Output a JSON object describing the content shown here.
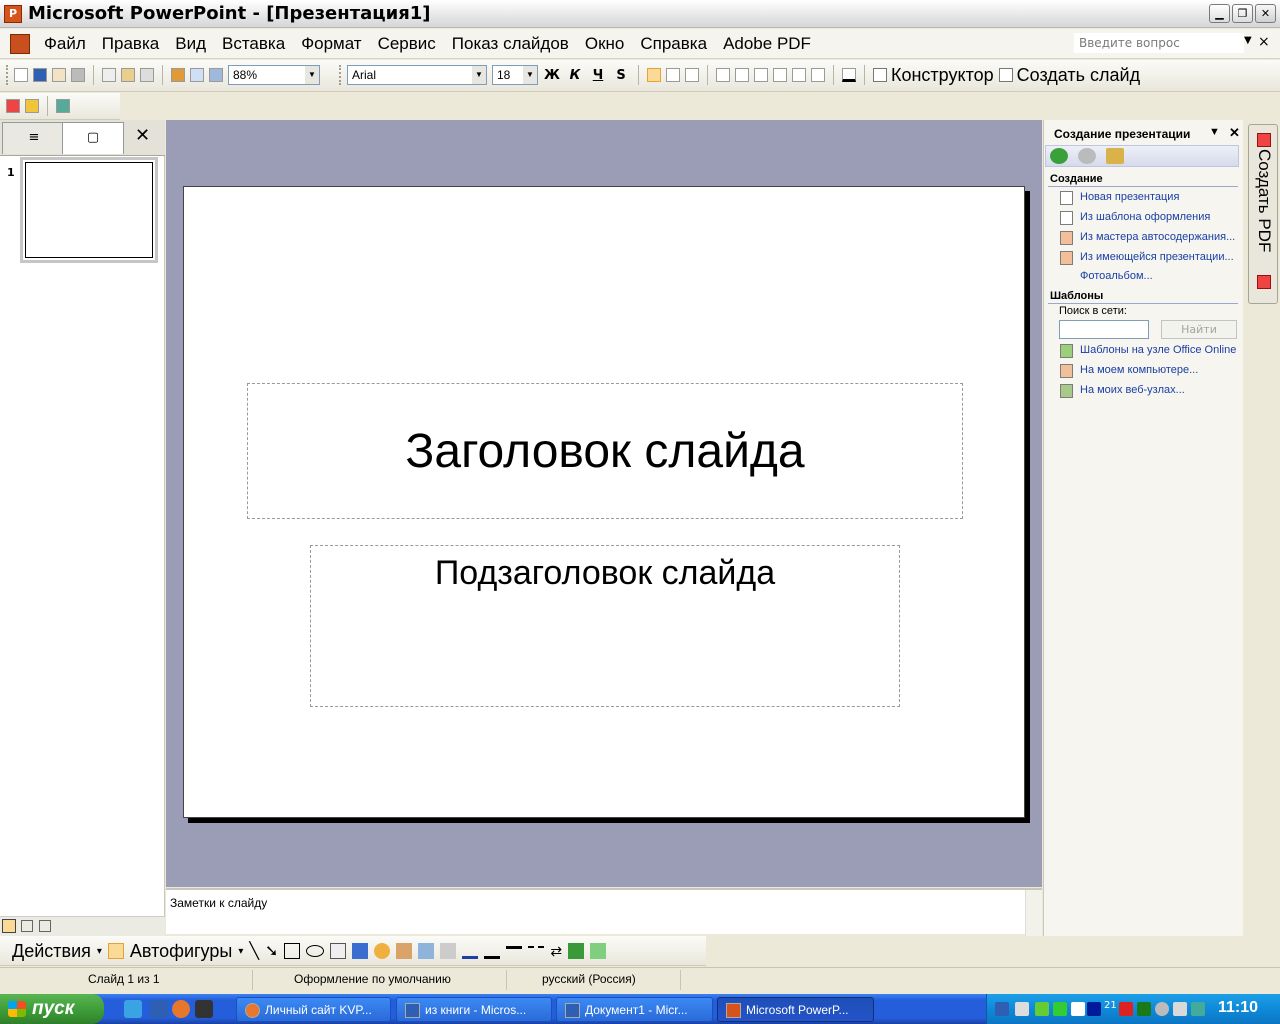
{
  "window": {
    "title": "Microsoft PowerPoint - [Презентация1]",
    "minimize_glyph": "▁",
    "restore_glyph": "❐",
    "close_glyph": "✕"
  },
  "menu": {
    "items": [
      "Файл",
      "Правка",
      "Вид",
      "Вставка",
      "Формат",
      "Сервис",
      "Показ слайдов",
      "Окно",
      "Справка",
      "Adobe PDF"
    ],
    "ask_placeholder": "Введите вопрос",
    "close_glyph": "×"
  },
  "toolbar": {
    "zoom": "88%",
    "font": "Arial",
    "size": "18",
    "bold": "Ж",
    "italic": "К",
    "underline": "Ч",
    "shadow": "S",
    "designer": "Конструктор",
    "new_slide": "Создать слайд"
  },
  "left_pane": {
    "close_glyph": "✕",
    "slide_number": "1"
  },
  "slide": {
    "title": "Заголовок слайда",
    "subtitle": "Подзаголовок слайда"
  },
  "notes": {
    "text": "Заметки к слайду"
  },
  "task_pane": {
    "title": "Создание презентации",
    "section_create": "Создание",
    "create_links": [
      "Новая презентация",
      "Из шаблона оформления",
      "Из мастера автосодержания...",
      "Из имеющейся презентации...",
      "Фотоальбом..."
    ],
    "section_templates": "Шаблоны",
    "search_label": "Поиск в сети:",
    "find_button": "Найти",
    "template_links": [
      "Шаблоны на узле Office Online",
      "На моем компьютере...",
      "На моих веб-узлах..."
    ],
    "pdf_tab": "Создать PDF"
  },
  "draw_toolbar": {
    "actions": "Действия",
    "autoshapes": "Автофигуры"
  },
  "status": {
    "slide": "Слайд 1 из 1",
    "design": "Оформление по умолчанию",
    "language": "русский (Россия)"
  },
  "taskbar": {
    "start": "пуск",
    "tasks": [
      "Личный сайт KVP...",
      "из книги - Micros...",
      "Документ1 - Micr...",
      "Microsoft PowerP..."
    ],
    "tray_number": "21",
    "clock": "11:10"
  },
  "colors": {
    "workspace": "#9a9db5",
    "taskbar": "#245edb",
    "start": "#3c9a36",
    "link": "#1a3fa5"
  }
}
